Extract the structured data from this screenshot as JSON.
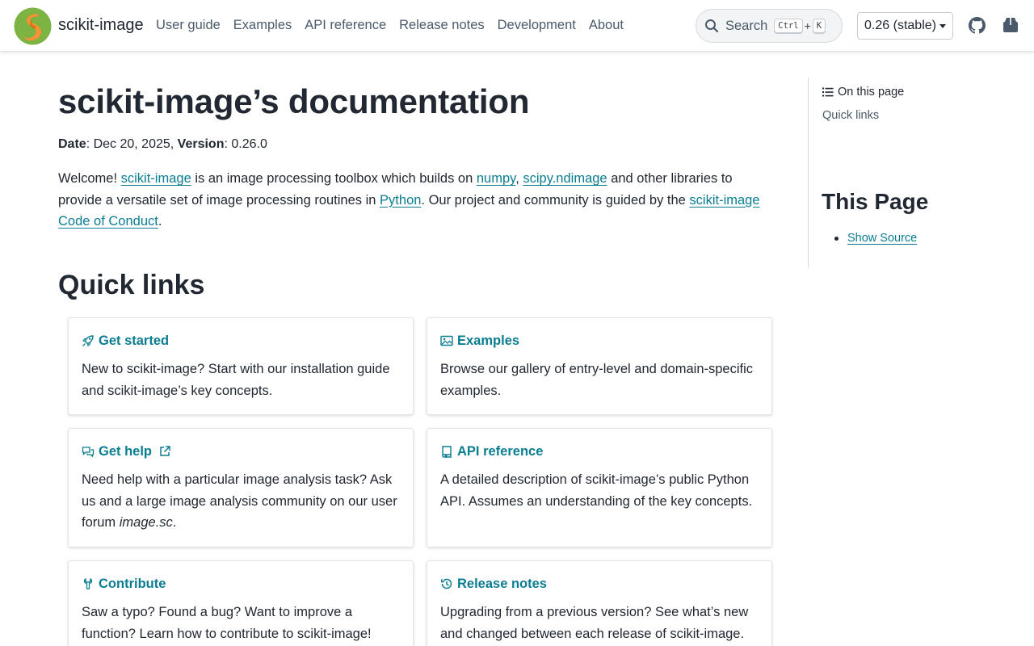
{
  "header": {
    "brand": "scikit-image",
    "nav": [
      "User guide",
      "Examples",
      "API reference",
      "Release notes",
      "Development",
      "About"
    ],
    "search": {
      "label": "Search",
      "key1": "Ctrl",
      "plus": "+",
      "key2": "K"
    },
    "version": "0.26 (stable)"
  },
  "main": {
    "title": "scikit-image’s documentation",
    "meta": {
      "date_label": "Date",
      "date_value": ": Dec 20, 2025, ",
      "version_label": "Version",
      "version_value": ": 0.26.0"
    },
    "intro": {
      "p1": "Welcome! ",
      "link1": "scikit-image",
      "p2": " is an image processing toolbox which builds on ",
      "link2": "numpy",
      "p3": ", ",
      "link3": "scipy.ndimage",
      "p4": " and other libraries to provide a versatile set of image processing routines in ",
      "link4": "Python",
      "p5": ". Our project and community is guided by the ",
      "link5": "scikit-image Code of Conduct",
      "p6": "."
    },
    "quick_links_heading": "Quick links",
    "cards": {
      "get_started": {
        "title": "Get started",
        "body": "New to scikit-image? Start with our installation guide and scikit-image’s key concepts."
      },
      "examples": {
        "title": "Examples",
        "body": "Browse our gallery of entry-level and domain-specific examples."
      },
      "get_help": {
        "title": "Get help",
        "body_a": "Need help with a particular image analysis task? Ask us and a large image analysis community on our user forum ",
        "body_em": "image.sc",
        "body_b": "."
      },
      "api_reference": {
        "title": "API reference",
        "body": "A detailed description of scikit-image’s public Python API. Assumes an understanding of the key concepts."
      },
      "contribute": {
        "title": "Contribute",
        "body": "Saw a typo? Found a bug? Want to improve a function? Learn how to contribute to scikit-image!"
      },
      "release_notes": {
        "title": "Release notes",
        "body": "Upgrading from a previous version? See what’s new and changed between each release of scikit-image."
      }
    }
  },
  "sidebar": {
    "on_this_page": "On this page",
    "toc_item": "Quick links",
    "this_page_heading": "This Page",
    "show_source": "Show Source"
  },
  "colors": {
    "link": "#0a7d91",
    "text": "#222832",
    "nav": "#4a5a6a"
  },
  "icons": [
    "logo",
    "search-icon",
    "github-icon",
    "cube-icon",
    "list-icon",
    "rocket-icon",
    "image-icon",
    "chat-icon",
    "external-link-icon",
    "book-icon",
    "wrench-icon",
    "history-icon"
  ]
}
